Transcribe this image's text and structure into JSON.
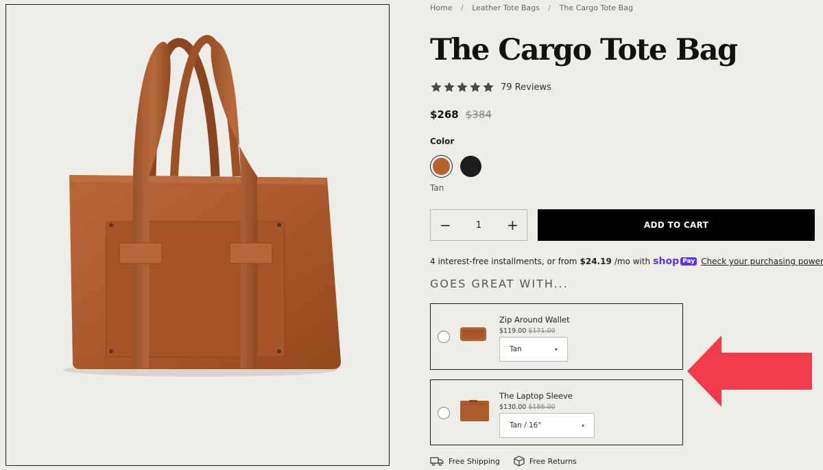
{
  "breadcrumb": [
    "Home",
    "Leather Tote Bags",
    "The Cargo Tote Bag"
  ],
  "breadcrumb_separator": "/",
  "product": {
    "title": "The Cargo Tote Bag",
    "rating": 5,
    "reviews": "79 Reviews",
    "price": "$268",
    "compare_price": "$384",
    "color_label": "Color",
    "selected_color": "Tan",
    "colors": [
      {
        "name": "Tan",
        "hex": "#b5622f",
        "selected": true
      },
      {
        "name": "Black",
        "hex": "#1c1c1c",
        "selected": false
      }
    ]
  },
  "quantity": {
    "minus": "−",
    "value": "1",
    "plus": "+"
  },
  "cart": {
    "add_label": "ADD TO CART"
  },
  "installments": {
    "prefix": "4 interest-free installments, or from",
    "amount": "$24.19",
    "suffix": "/mo with",
    "shop_logo": "shop",
    "shop_badge": "Pay",
    "link": "Check your purchasing power"
  },
  "upsell": {
    "heading": "GOES GREAT WITH...",
    "items": [
      {
        "name": "Zip Around Wallet",
        "price": "$119.00",
        "compare": "$171.00",
        "option": "Tan",
        "icon": "wallet-icon"
      },
      {
        "name": "The Laptop Sleeve",
        "price": "$130.00",
        "compare": "$186.00",
        "option": "Tan / 16\"",
        "icon": "laptop-sleeve-icon"
      }
    ]
  },
  "badges": [
    {
      "label": "Free Shipping",
      "icon": "truck-icon"
    },
    {
      "label": "Free Returns",
      "icon": "box-icon"
    }
  ],
  "colors": {
    "accent": "#000000",
    "annotation_arrow": "#f23a4c",
    "shop_pay": "#5a31f4",
    "background": "#efede8"
  }
}
